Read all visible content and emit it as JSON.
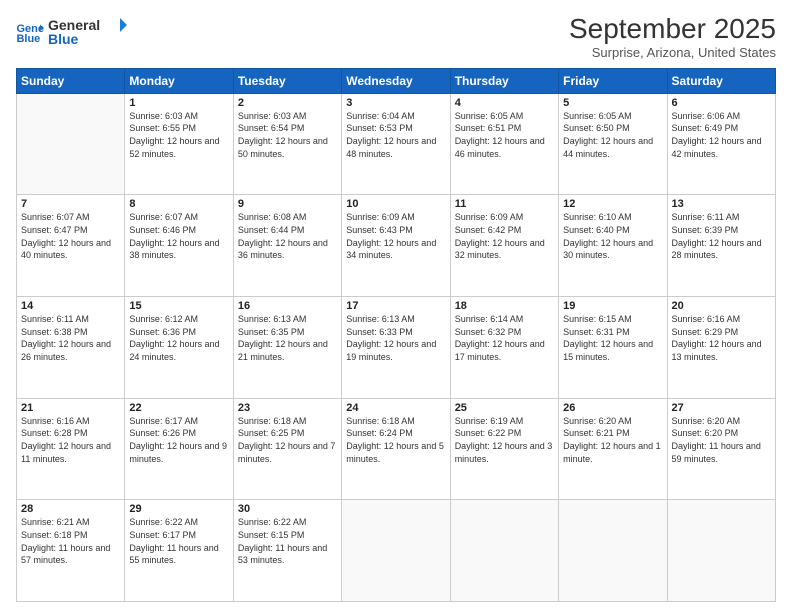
{
  "logo": {
    "line1": "General",
    "line2": "Blue"
  },
  "title": "September 2025",
  "subtitle": "Surprise, Arizona, United States",
  "weekdays": [
    "Sunday",
    "Monday",
    "Tuesday",
    "Wednesday",
    "Thursday",
    "Friday",
    "Saturday"
  ],
  "weeks": [
    [
      {
        "day": "",
        "sunrise": "",
        "sunset": "",
        "daylight": ""
      },
      {
        "day": "1",
        "sunrise": "Sunrise: 6:03 AM",
        "sunset": "Sunset: 6:55 PM",
        "daylight": "Daylight: 12 hours and 52 minutes."
      },
      {
        "day": "2",
        "sunrise": "Sunrise: 6:03 AM",
        "sunset": "Sunset: 6:54 PM",
        "daylight": "Daylight: 12 hours and 50 minutes."
      },
      {
        "day": "3",
        "sunrise": "Sunrise: 6:04 AM",
        "sunset": "Sunset: 6:53 PM",
        "daylight": "Daylight: 12 hours and 48 minutes."
      },
      {
        "day": "4",
        "sunrise": "Sunrise: 6:05 AM",
        "sunset": "Sunset: 6:51 PM",
        "daylight": "Daylight: 12 hours and 46 minutes."
      },
      {
        "day": "5",
        "sunrise": "Sunrise: 6:05 AM",
        "sunset": "Sunset: 6:50 PM",
        "daylight": "Daylight: 12 hours and 44 minutes."
      },
      {
        "day": "6",
        "sunrise": "Sunrise: 6:06 AM",
        "sunset": "Sunset: 6:49 PM",
        "daylight": "Daylight: 12 hours and 42 minutes."
      }
    ],
    [
      {
        "day": "7",
        "sunrise": "Sunrise: 6:07 AM",
        "sunset": "Sunset: 6:47 PM",
        "daylight": "Daylight: 12 hours and 40 minutes."
      },
      {
        "day": "8",
        "sunrise": "Sunrise: 6:07 AM",
        "sunset": "Sunset: 6:46 PM",
        "daylight": "Daylight: 12 hours and 38 minutes."
      },
      {
        "day": "9",
        "sunrise": "Sunrise: 6:08 AM",
        "sunset": "Sunset: 6:44 PM",
        "daylight": "Daylight: 12 hours and 36 minutes."
      },
      {
        "day": "10",
        "sunrise": "Sunrise: 6:09 AM",
        "sunset": "Sunset: 6:43 PM",
        "daylight": "Daylight: 12 hours and 34 minutes."
      },
      {
        "day": "11",
        "sunrise": "Sunrise: 6:09 AM",
        "sunset": "Sunset: 6:42 PM",
        "daylight": "Daylight: 12 hours and 32 minutes."
      },
      {
        "day": "12",
        "sunrise": "Sunrise: 6:10 AM",
        "sunset": "Sunset: 6:40 PM",
        "daylight": "Daylight: 12 hours and 30 minutes."
      },
      {
        "day": "13",
        "sunrise": "Sunrise: 6:11 AM",
        "sunset": "Sunset: 6:39 PM",
        "daylight": "Daylight: 12 hours and 28 minutes."
      }
    ],
    [
      {
        "day": "14",
        "sunrise": "Sunrise: 6:11 AM",
        "sunset": "Sunset: 6:38 PM",
        "daylight": "Daylight: 12 hours and 26 minutes."
      },
      {
        "day": "15",
        "sunrise": "Sunrise: 6:12 AM",
        "sunset": "Sunset: 6:36 PM",
        "daylight": "Daylight: 12 hours and 24 minutes."
      },
      {
        "day": "16",
        "sunrise": "Sunrise: 6:13 AM",
        "sunset": "Sunset: 6:35 PM",
        "daylight": "Daylight: 12 hours and 21 minutes."
      },
      {
        "day": "17",
        "sunrise": "Sunrise: 6:13 AM",
        "sunset": "Sunset: 6:33 PM",
        "daylight": "Daylight: 12 hours and 19 minutes."
      },
      {
        "day": "18",
        "sunrise": "Sunrise: 6:14 AM",
        "sunset": "Sunset: 6:32 PM",
        "daylight": "Daylight: 12 hours and 17 minutes."
      },
      {
        "day": "19",
        "sunrise": "Sunrise: 6:15 AM",
        "sunset": "Sunset: 6:31 PM",
        "daylight": "Daylight: 12 hours and 15 minutes."
      },
      {
        "day": "20",
        "sunrise": "Sunrise: 6:16 AM",
        "sunset": "Sunset: 6:29 PM",
        "daylight": "Daylight: 12 hours and 13 minutes."
      }
    ],
    [
      {
        "day": "21",
        "sunrise": "Sunrise: 6:16 AM",
        "sunset": "Sunset: 6:28 PM",
        "daylight": "Daylight: 12 hours and 11 minutes."
      },
      {
        "day": "22",
        "sunrise": "Sunrise: 6:17 AM",
        "sunset": "Sunset: 6:26 PM",
        "daylight": "Daylight: 12 hours and 9 minutes."
      },
      {
        "day": "23",
        "sunrise": "Sunrise: 6:18 AM",
        "sunset": "Sunset: 6:25 PM",
        "daylight": "Daylight: 12 hours and 7 minutes."
      },
      {
        "day": "24",
        "sunrise": "Sunrise: 6:18 AM",
        "sunset": "Sunset: 6:24 PM",
        "daylight": "Daylight: 12 hours and 5 minutes."
      },
      {
        "day": "25",
        "sunrise": "Sunrise: 6:19 AM",
        "sunset": "Sunset: 6:22 PM",
        "daylight": "Daylight: 12 hours and 3 minutes."
      },
      {
        "day": "26",
        "sunrise": "Sunrise: 6:20 AM",
        "sunset": "Sunset: 6:21 PM",
        "daylight": "Daylight: 12 hours and 1 minute."
      },
      {
        "day": "27",
        "sunrise": "Sunrise: 6:20 AM",
        "sunset": "Sunset: 6:20 PM",
        "daylight": "Daylight: 11 hours and 59 minutes."
      }
    ],
    [
      {
        "day": "28",
        "sunrise": "Sunrise: 6:21 AM",
        "sunset": "Sunset: 6:18 PM",
        "daylight": "Daylight: 11 hours and 57 minutes."
      },
      {
        "day": "29",
        "sunrise": "Sunrise: 6:22 AM",
        "sunset": "Sunset: 6:17 PM",
        "daylight": "Daylight: 11 hours and 55 minutes."
      },
      {
        "day": "30",
        "sunrise": "Sunrise: 6:22 AM",
        "sunset": "Sunset: 6:15 PM",
        "daylight": "Daylight: 11 hours and 53 minutes."
      },
      {
        "day": "",
        "sunrise": "",
        "sunset": "",
        "daylight": ""
      },
      {
        "day": "",
        "sunrise": "",
        "sunset": "",
        "daylight": ""
      },
      {
        "day": "",
        "sunrise": "",
        "sunset": "",
        "daylight": ""
      },
      {
        "day": "",
        "sunrise": "",
        "sunset": "",
        "daylight": ""
      }
    ]
  ]
}
